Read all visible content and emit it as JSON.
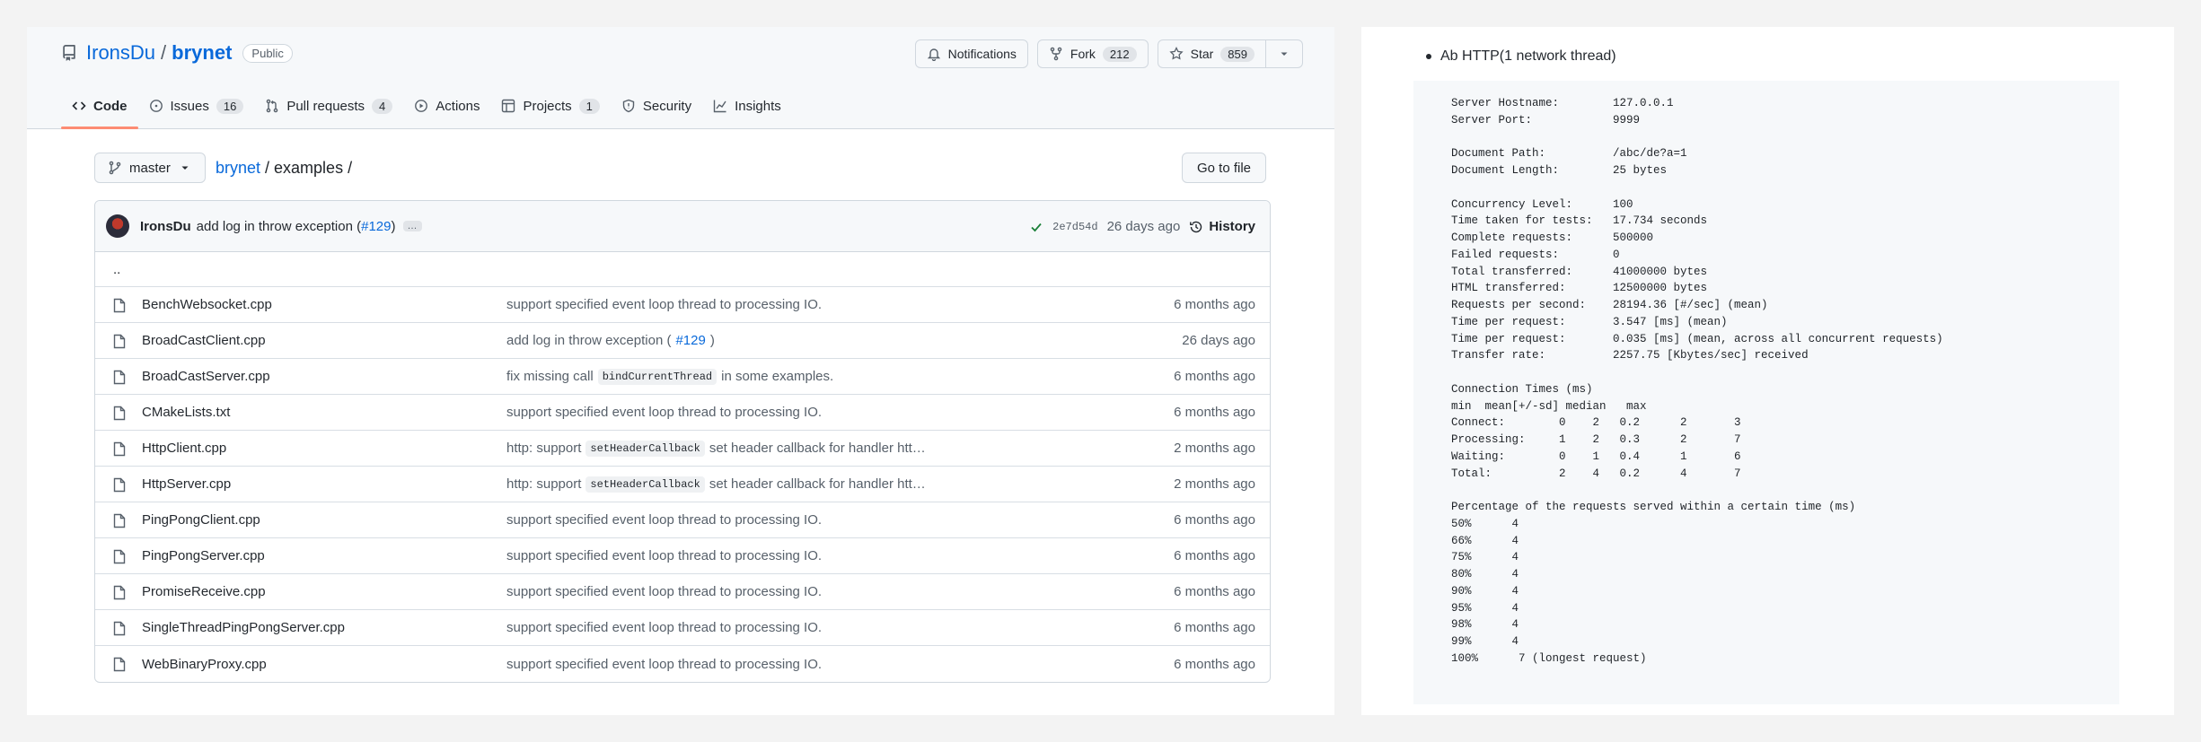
{
  "repo": {
    "owner": "IronsDu",
    "separator": "/",
    "name": "brynet",
    "visibility": "Public"
  },
  "header_actions": {
    "notifications_label": "Notifications",
    "fork_label": "Fork",
    "fork_count": "212",
    "star_label": "Star",
    "star_count": "859"
  },
  "tabs": [
    {
      "label": "Code",
      "count": "",
      "icon": "code-icon",
      "active": true
    },
    {
      "label": "Issues",
      "count": "16",
      "icon": "issue-icon"
    },
    {
      "label": "Pull requests",
      "count": "4",
      "icon": "pull-request-icon"
    },
    {
      "label": "Actions",
      "count": "",
      "icon": "play-icon"
    },
    {
      "label": "Projects",
      "count": "1",
      "icon": "table-icon"
    },
    {
      "label": "Security",
      "count": "",
      "icon": "shield-icon"
    },
    {
      "label": "Insights",
      "count": "",
      "icon": "graph-icon"
    }
  ],
  "toolbar": {
    "branch": "master",
    "breadcrumb_repo": "brynet",
    "breadcrumb_rest": " / examples /",
    "go_to_file": "Go to file"
  },
  "latest_commit": {
    "author": "IronsDu",
    "message": "add log in throw exception (",
    "link": "#129",
    "close": ")",
    "ellipsis": "…",
    "sha": "2e7d54d",
    "age": "26 days ago",
    "history_label": "History"
  },
  "parent_dir": "..",
  "files": [
    {
      "name": "BenchWebsocket.cpp",
      "msg_pre": "support specified event loop thread to processing IO.",
      "code": "",
      "link": "",
      "msg_post": "",
      "age": "6 months ago"
    },
    {
      "name": "BroadCastClient.cpp",
      "msg_pre": "add log in throw exception (",
      "code": "",
      "link": "#129",
      "msg_post": ")",
      "age": "26 days ago"
    },
    {
      "name": "BroadCastServer.cpp",
      "msg_pre": "fix missing call ",
      "code": "bindCurrentThread",
      "link": "",
      "msg_post": " in some examples.",
      "age": "6 months ago"
    },
    {
      "name": "CMakeLists.txt",
      "msg_pre": "support specified event loop thread to processing IO.",
      "code": "",
      "link": "",
      "msg_post": "",
      "age": "6 months ago"
    },
    {
      "name": "HttpClient.cpp",
      "msg_pre": "http: support ",
      "code": "setHeaderCallback",
      "link": "",
      "msg_post": " set header callback for handler htt…",
      "age": "2 months ago"
    },
    {
      "name": "HttpServer.cpp",
      "msg_pre": "http: support ",
      "code": "setHeaderCallback",
      "link": "",
      "msg_post": " set header callback for handler htt…",
      "age": "2 months ago"
    },
    {
      "name": "PingPongClient.cpp",
      "msg_pre": "support specified event loop thread to processing IO.",
      "code": "",
      "link": "",
      "msg_post": "",
      "age": "6 months ago"
    },
    {
      "name": "PingPongServer.cpp",
      "msg_pre": "support specified event loop thread to processing IO.",
      "code": "",
      "link": "",
      "msg_post": "",
      "age": "6 months ago"
    },
    {
      "name": "PromiseReceive.cpp",
      "msg_pre": "support specified event loop thread to processing IO.",
      "code": "",
      "link": "",
      "msg_post": "",
      "age": "6 months ago"
    },
    {
      "name": "SingleThreadPingPongServer.cpp",
      "msg_pre": "support specified event loop thread to processing IO.",
      "code": "",
      "link": "",
      "msg_post": "",
      "age": "6 months ago"
    },
    {
      "name": "WebBinaryProxy.cpp",
      "msg_pre": "support specified event loop thread to processing IO.",
      "code": "",
      "link": "",
      "msg_post": "",
      "age": "6 months ago"
    }
  ],
  "doc": {
    "bullet": "Ab HTTP(1 network thread)",
    "benchmark_output": "Server Hostname:        127.0.0.1\nServer Port:            9999\n\nDocument Path:          /abc/de?a=1\nDocument Length:        25 bytes\n\nConcurrency Level:      100\nTime taken for tests:   17.734 seconds\nComplete requests:      500000\nFailed requests:        0\nTotal transferred:      41000000 bytes\nHTML transferred:       12500000 bytes\nRequests per second:    28194.36 [#/sec] (mean)\nTime per request:       3.547 [ms] (mean)\nTime per request:       0.035 [ms] (mean, across all concurrent requests)\nTransfer rate:          2257.75 [Kbytes/sec] received\n\nConnection Times (ms)\nmin  mean[+/-sd] median   max\nConnect:        0    2   0.2      2       3\nProcessing:     1    2   0.3      2       7\nWaiting:        0    1   0.4      1       6\nTotal:          2    4   0.2      4       7\n\nPercentage of the requests served within a certain time (ms)\n50%      4\n66%      4\n75%      4\n80%      4\n90%      4\n95%      4\n98%      4\n99%      4\n100%      7 (longest request)"
  }
}
